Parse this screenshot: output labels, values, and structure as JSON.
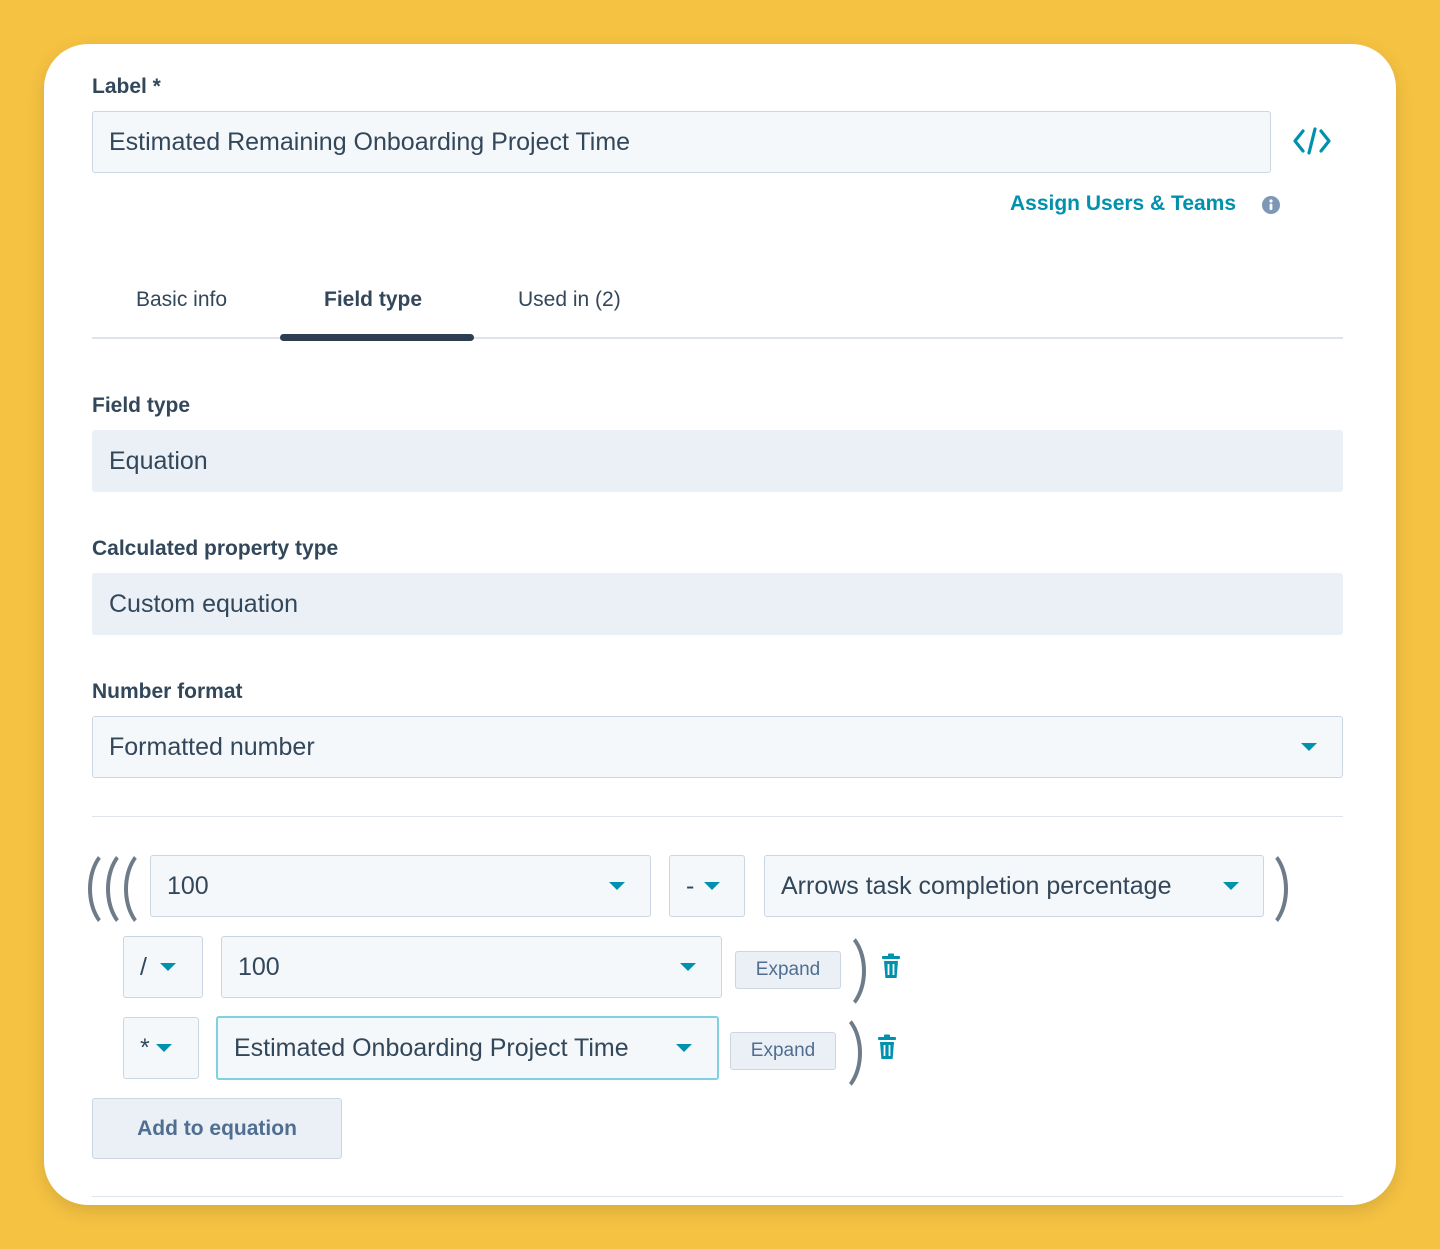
{
  "label_section": {
    "label": "Label *",
    "value": "Estimated Remaining Onboarding Project Time",
    "embed_icon": "code-icon",
    "assign_link": "Assign Users & Teams",
    "info_icon": "info-icon"
  },
  "tabs": [
    {
      "label": "Basic info",
      "active": false
    },
    {
      "label": "Field type",
      "active": true
    },
    {
      "label": "Used in (2)",
      "active": false
    }
  ],
  "field_type": {
    "label": "Field type",
    "value": "Equation"
  },
  "calculated_property_type": {
    "label": "Calculated property type",
    "value": "Custom equation"
  },
  "number_format": {
    "label": "Number format",
    "value": "Formatted number"
  },
  "equation": {
    "row1": {
      "left": "100",
      "operator": "-",
      "right": "Arrows task completion percentage"
    },
    "row2": {
      "operator": "/",
      "value": "100",
      "expand": "Expand"
    },
    "row3": {
      "operator": "*",
      "value": "Estimated Onboarding Project Time",
      "expand": "Expand"
    },
    "add_button": "Add to equation",
    "delete_icon": "trash-icon"
  },
  "colors": {
    "accent": "#0091AE",
    "text": "#33475B",
    "background": "#F5C242",
    "focus": "#7FD1DE"
  }
}
